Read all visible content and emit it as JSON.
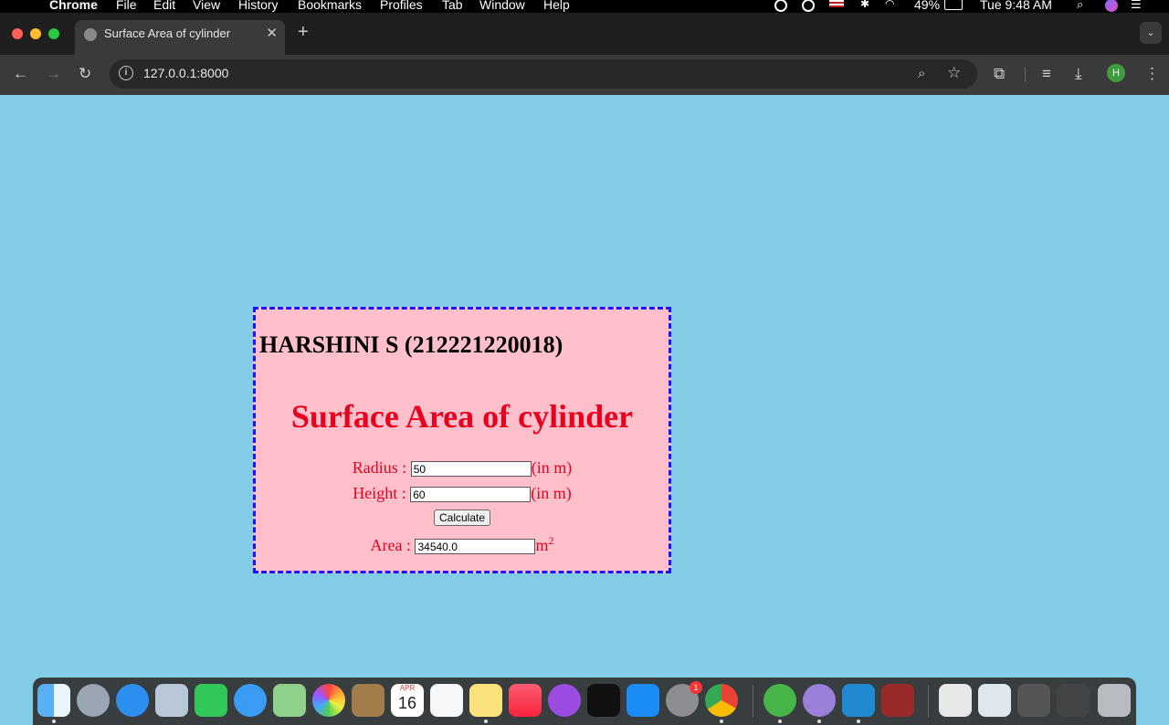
{
  "menubar": {
    "apple": "",
    "app": "Chrome",
    "items": [
      "File",
      "Edit",
      "View",
      "History",
      "Bookmarks",
      "Profiles",
      "Tab",
      "Window",
      "Help"
    ],
    "battery": "49%",
    "clock": "Tue 9:48 AM"
  },
  "browser": {
    "tab_title": "Surface Area of cylinder",
    "url": "127.0.0.1:8000",
    "profile_initial": "H"
  },
  "page": {
    "student": "HARSHINI S (212221220018)",
    "heading": "Surface Area of cylinder",
    "radius_label": "Radius :",
    "radius_value": "50",
    "height_label": "Height :",
    "height_value": "60",
    "unit": "(in m)",
    "calculate_label": "Calculate",
    "area_label": "Area :",
    "area_value": "34540.0",
    "area_unit": "m",
    "area_unit_exp": "2"
  },
  "dock": {
    "calendar_month": "APR",
    "calendar_day": "16",
    "settings_badge": "1"
  }
}
